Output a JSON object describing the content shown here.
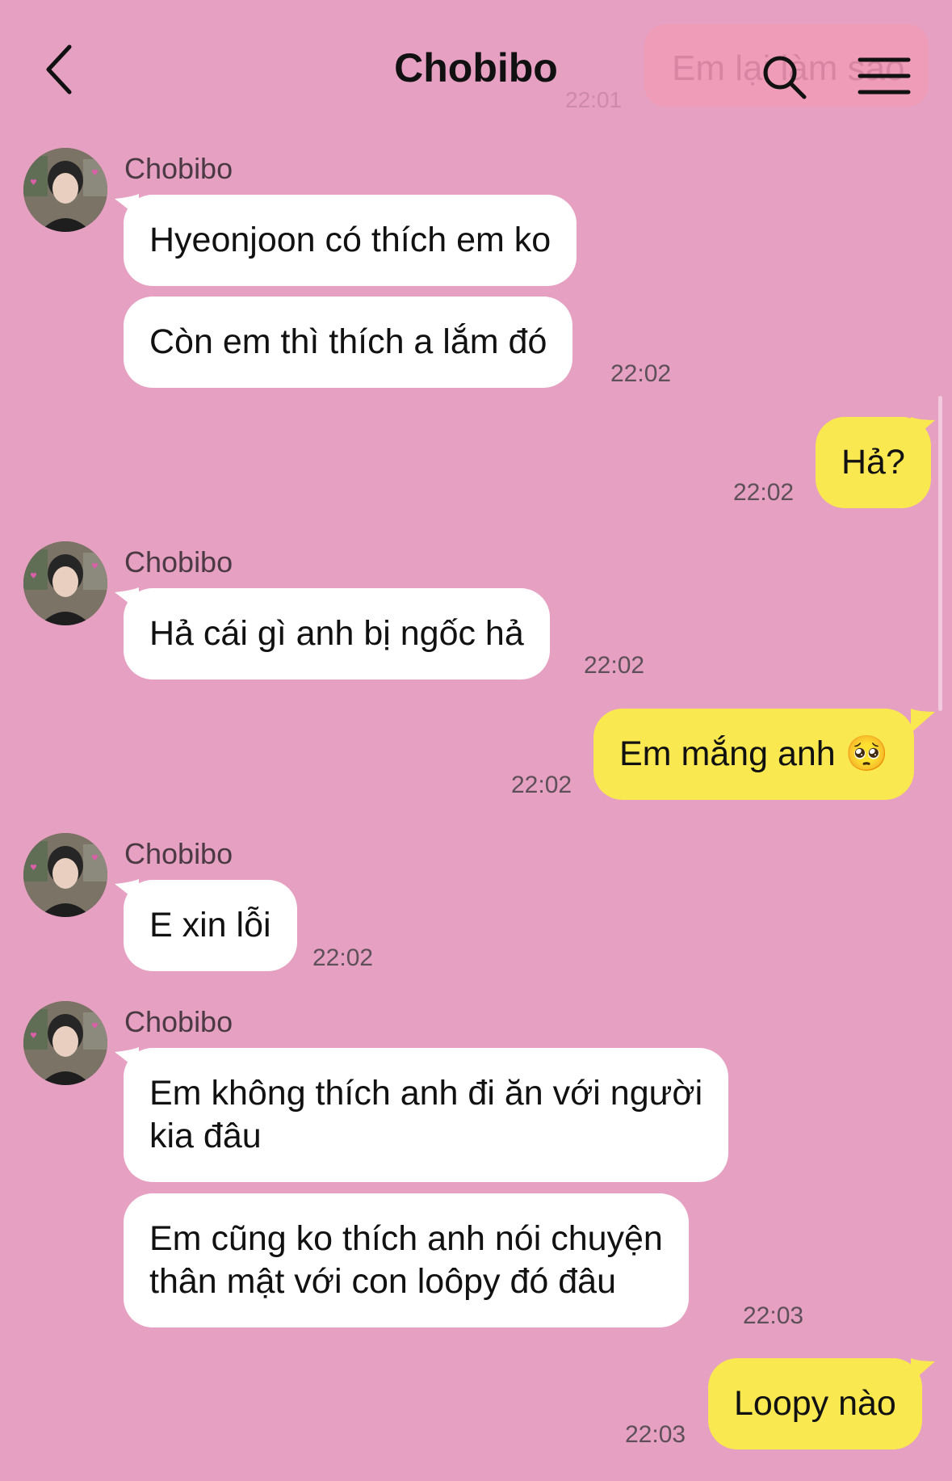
{
  "header": {
    "title": "Chobibo",
    "back_icon": "chevron-left-icon",
    "search_icon": "search-icon",
    "menu_icon": "menu-icon"
  },
  "search_preview": {
    "text": "Em lại làm sao",
    "time": "22:01"
  },
  "messages": [
    {
      "sender": "Chobibo",
      "text": "Hyeonjoon có thích em ko"
    },
    {
      "text": "Còn em thì thích a lắm đó",
      "time": "22:02"
    },
    {
      "text": "Hả?",
      "time": "22:02"
    },
    {
      "sender": "Chobibo",
      "text": "Hả cái gì anh bị ngốc hả",
      "time": "22:02"
    },
    {
      "text": "Em mắng anh",
      "emoji": "🥺",
      "time": "22:02"
    },
    {
      "sender": "Chobibo",
      "text": "E xin lỗi",
      "time": "22:02"
    },
    {
      "sender": "Chobibo",
      "line1": "Em không thích anh đi ăn với người",
      "line2": "kia đâu"
    },
    {
      "line1": "Em cũng ko thích anh nói chuyện",
      "line2": "thân mật với con loôpy đó đâu",
      "time": "22:03"
    },
    {
      "text": "Loopy nào",
      "time": "22:03"
    }
  ],
  "colors": {
    "background": "#e6a0c1",
    "incoming_bubble": "#ffffff",
    "outgoing_bubble": "#f9e84f"
  }
}
